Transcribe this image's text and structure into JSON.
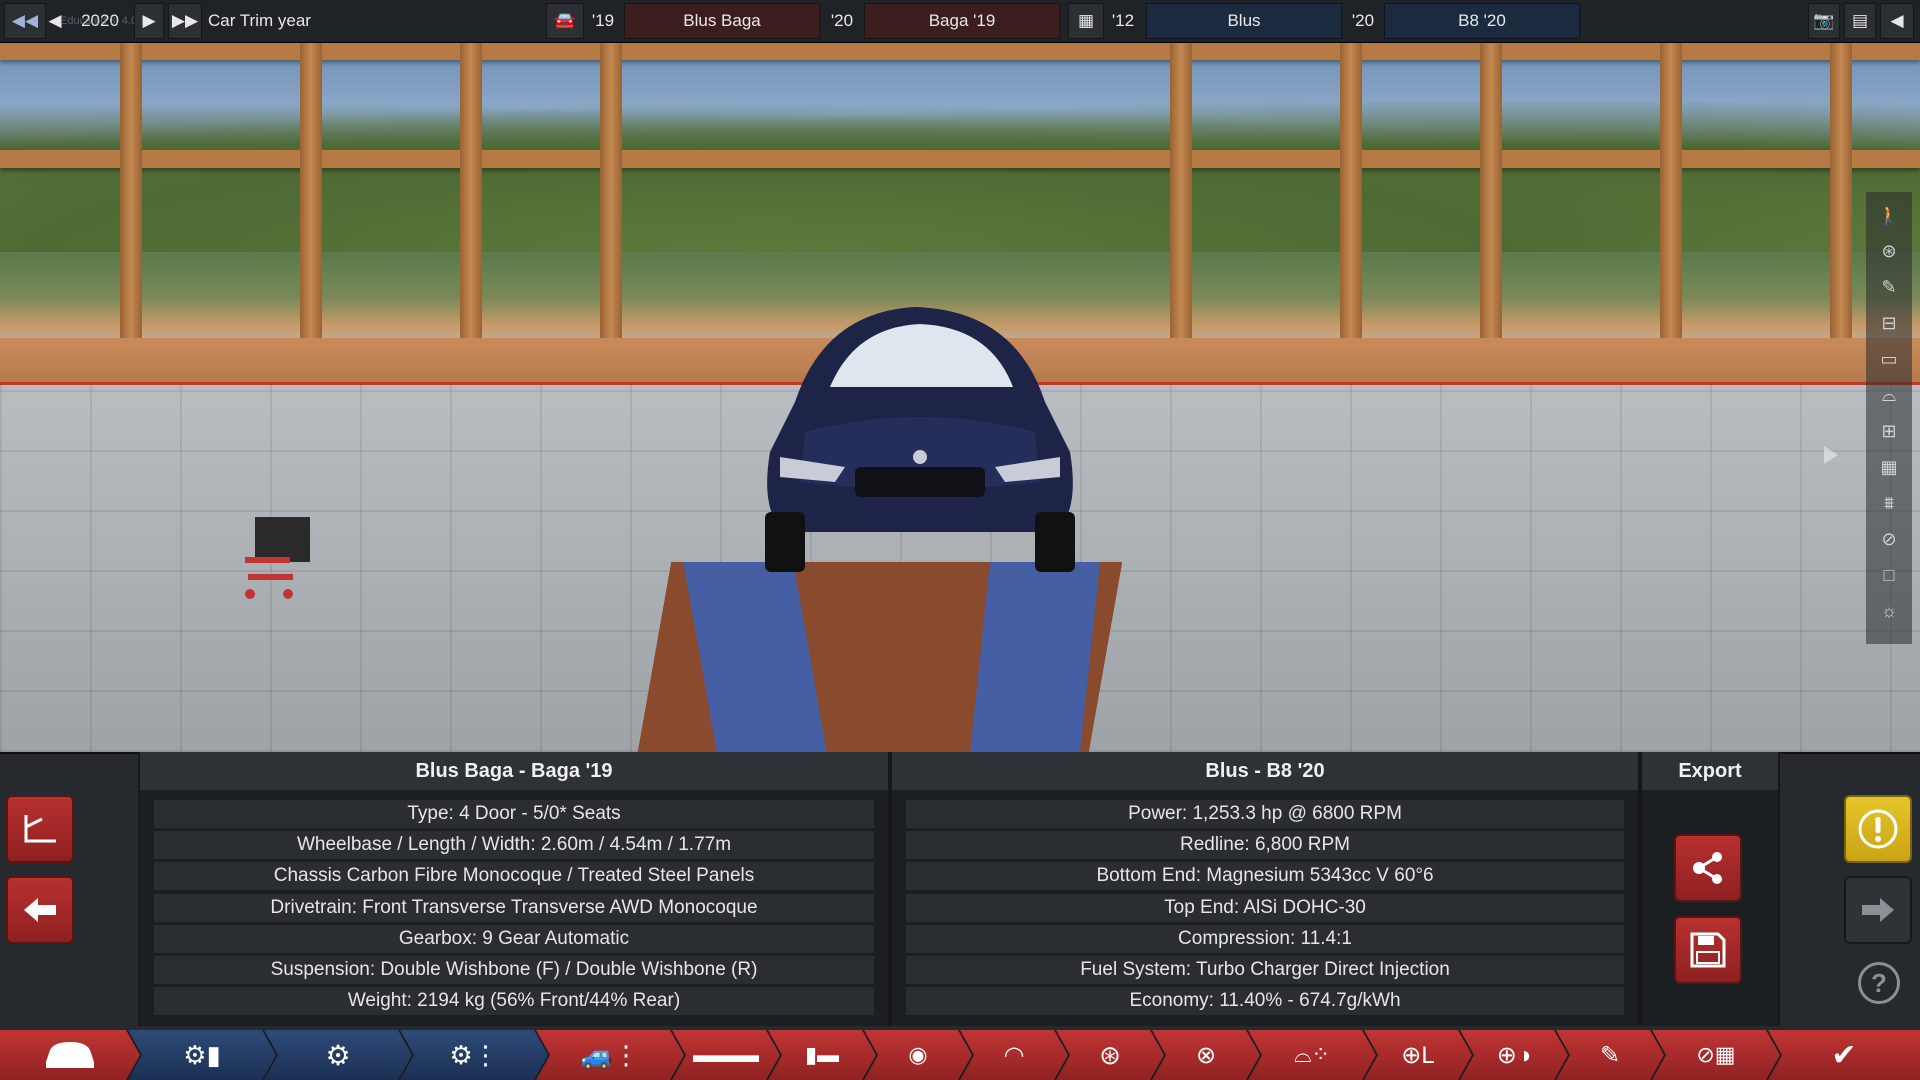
{
  "topbar": {
    "year": "2020",
    "year_label": "Car Trim year",
    "left_year_a": "'19",
    "left_name_a": "Blus Baga",
    "left_year_b": "'20",
    "left_name_b": "Baga '19",
    "right_year_a": "'12",
    "right_name_a": "Blus",
    "right_year_b": "'20",
    "right_name_b": "B8 '20",
    "overlay_text": "Educated 3, 4.0"
  },
  "panel": {
    "left_title": "Blus Baga - Baga '19",
    "right_title": "Blus - B8 '20",
    "export_title": "Export",
    "left_rows": [
      "Type: 4 Door - 5/0* Seats",
      "Wheelbase / Length / Width: 2.60m / 4.54m / 1.77m",
      "Chassis Carbon Fibre Monocoque / Treated Steel Panels",
      "Drivetrain: Front Transverse Transverse AWD Monocoque",
      "Gearbox: 9 Gear Automatic",
      "Suspension: Double Wishbone (F) / Double Wishbone (R)",
      "Weight: 2194 kg (56% Front/44% Rear)"
    ],
    "right_rows": [
      "Power: 1,253.3 hp @ 6800 RPM",
      "Redline:  6,800 RPM",
      "Bottom End: Magnesium 5343cc V 60°6",
      "Top End: AlSi DOHC-30",
      "Compression: 11.4:1",
      "Fuel System: Turbo Charger Direct Injection",
      "Economy: 11.40% - 674.7g/kWh"
    ]
  },
  "colors": {
    "accent_red": "#b93030",
    "accent_blue": "#2e4b7a",
    "warning_yellow": "#e6c52b"
  },
  "nav_tabs": [
    {
      "icon": "car-front-icon",
      "color": "red"
    },
    {
      "icon": "engine-body-icon",
      "color": "blue"
    },
    {
      "icon": "engine-icon",
      "color": "blue"
    },
    {
      "icon": "engine-tune-icon",
      "color": "blue"
    },
    {
      "icon": "car-trim-icon",
      "color": "red"
    },
    {
      "icon": "car-seats-icon",
      "color": "red"
    },
    {
      "icon": "interior-icon",
      "color": "red"
    },
    {
      "icon": "safety-icon",
      "color": "red"
    },
    {
      "icon": "suspension-icon",
      "color": "red"
    },
    {
      "icon": "wheel-icon",
      "color": "red"
    },
    {
      "icon": "brake-icon",
      "color": "red"
    },
    {
      "icon": "aero-icon",
      "color": "red"
    },
    {
      "icon": "steering-icon",
      "color": "red"
    },
    {
      "icon": "tyre-icon",
      "color": "red"
    },
    {
      "icon": "test-icon",
      "color": "red"
    },
    {
      "icon": "race-flag-icon",
      "color": "red"
    },
    {
      "icon": "finish-check-icon",
      "color": "red"
    }
  ]
}
